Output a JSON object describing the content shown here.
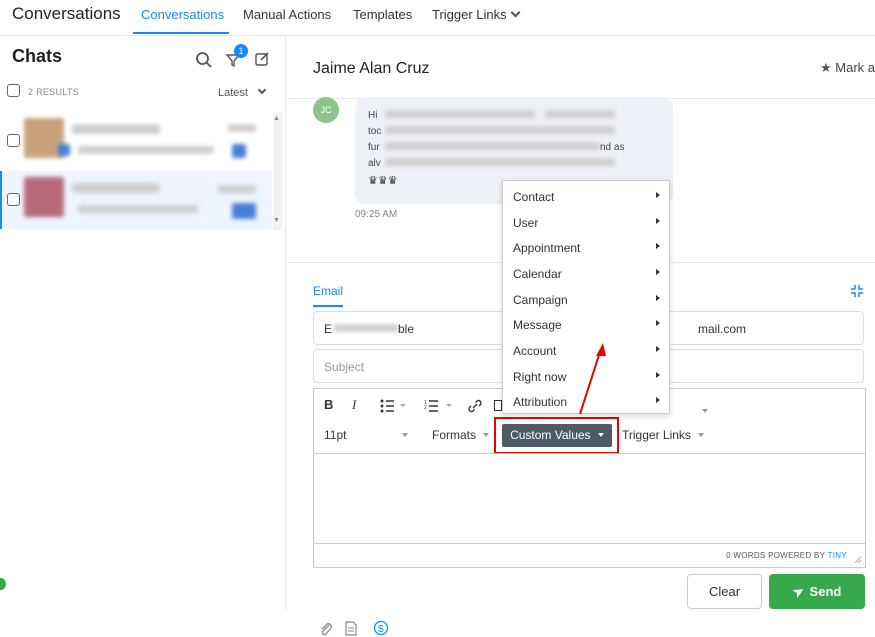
{
  "app": {
    "title": "Conversations"
  },
  "nav": {
    "tabs": [
      {
        "label": "Conversations"
      },
      {
        "label": "Manual Actions"
      },
      {
        "label": "Templates"
      },
      {
        "label": "Trigger Links"
      }
    ]
  },
  "sidebar": {
    "title": "Chats",
    "filter_badge": "1",
    "results_label": "2 RESULTS",
    "sort_label": "Latest"
  },
  "conversation": {
    "contact_name": "Jaime Alan Cruz",
    "mark_label": "Mark a",
    "avatar_initials": "JC",
    "message_time": "09:25 AM",
    "message_fragments": [
      "Hi",
      "toc",
      "fur",
      "nd as",
      "alv"
    ]
  },
  "composer": {
    "channel_tab": "Email",
    "from_prefix": "E",
    "from_suffix": "ble",
    "to_value": "mail.com",
    "subject_placeholder": "Subject",
    "font_size": "11pt",
    "formats_label": "Formats",
    "custom_values_label": "Custom Values",
    "trigger_links_label": "Trigger Links",
    "status": "0 WORDS POWERED BY",
    "status_brand": "TINY",
    "clear_label": "Clear",
    "send_label": "Send"
  },
  "menu": {
    "items": [
      {
        "label": "Contact"
      },
      {
        "label": "User"
      },
      {
        "label": "Appointment"
      },
      {
        "label": "Calendar"
      },
      {
        "label": "Campaign"
      },
      {
        "label": "Message"
      },
      {
        "label": "Account"
      },
      {
        "label": "Right now"
      },
      {
        "label": "Attribution"
      }
    ]
  },
  "colors": {
    "accent": "#188bf6",
    "send": "#38a94a",
    "annotation": "#e00000",
    "custom_values_bg": "#4e5a65"
  }
}
